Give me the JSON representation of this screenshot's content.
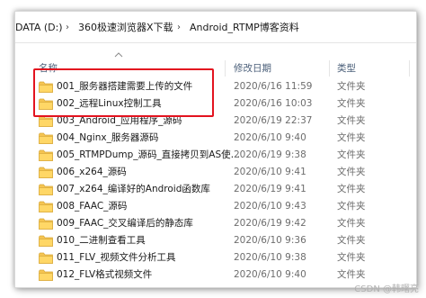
{
  "breadcrumb": {
    "items": [
      "DATA (D:)",
      "360极速浏览器X下载",
      "Android_RTMP博客资料"
    ]
  },
  "columns": {
    "name": "名称",
    "modified": "修改日期",
    "type": "类型"
  },
  "files": [
    {
      "name": "001_服务器搭建需要上传的文件",
      "modified": "2020/6/16 11:59",
      "type": "文件夹"
    },
    {
      "name": "002_远程Linux控制工具",
      "modified": "2020/6/16 10:03",
      "type": "文件夹"
    },
    {
      "name": "003_Android_应用程序_源码",
      "modified": "2020/6/19 22:37",
      "type": "文件夹"
    },
    {
      "name": "004_Nginx_服务器源码",
      "modified": "2020/6/10 9:40",
      "type": "文件夹"
    },
    {
      "name": "005_RTMPDump_源码_直接拷贝到AS使…",
      "modified": "2020/6/19 9:38",
      "type": "文件夹"
    },
    {
      "name": "006_x264_源码",
      "modified": "2020/6/10 9:41",
      "type": "文件夹"
    },
    {
      "name": "007_x264_编译好的Android函数库",
      "modified": "2020/6/19 9:41",
      "type": "文件夹"
    },
    {
      "name": "008_FAAC_源码",
      "modified": "2020/6/10 9:43",
      "type": "文件夹"
    },
    {
      "name": "009_FAAC_交叉编译后的静态库",
      "modified": "2020/6/19 9:42",
      "type": "文件夹"
    },
    {
      "name": "010_二进制查看工具",
      "modified": "2020/6/10 9:36",
      "type": "文件夹"
    },
    {
      "name": "011_FLV_视频文件分析工具",
      "modified": "2020/6/10 9:38",
      "type": "文件夹"
    },
    {
      "name": "012_FLV格式视频文件",
      "modified": "2020/6/10 9:40",
      "type": "文件夹"
    }
  ],
  "watermark": "CSDN @韩曙亮",
  "colors": {
    "highlight_box": "#e3131f",
    "folder": "#f5c451",
    "header_text": "#4c607a"
  },
  "icons": {
    "folder": "folder-icon",
    "sort": "chevron-up-icon",
    "breadcrumb_separator": "chevron-right-icon"
  }
}
